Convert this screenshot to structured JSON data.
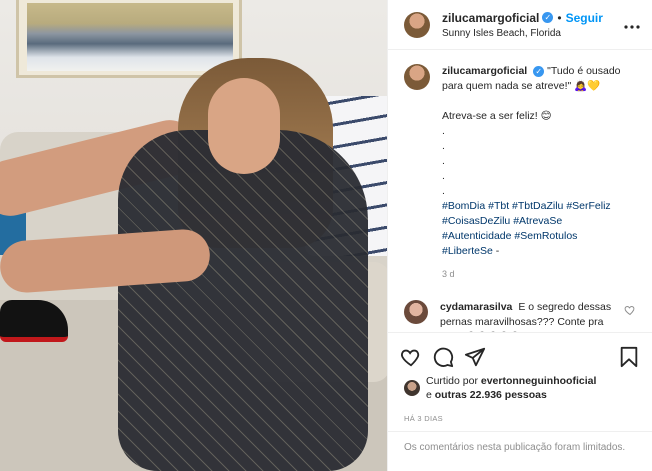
{
  "post": {
    "username": "zilucamargoficial",
    "follow_label": "Seguir",
    "separator": "•",
    "location": "Sunny Isles Beach, Florida",
    "more_label": "•••"
  },
  "caption": {
    "username": "zilucamargoficial",
    "lines": [
      "\"Tudo é ousado para quem nada se atreve!\" 🙇‍♀️💛",
      "",
      "Atreva-se a ser feliz! 😊",
      ".",
      ".",
      ".",
      ".",
      "."
    ],
    "hashtags": [
      "#BomDia",
      "#Tbt",
      "#TbtDaZilu",
      "#SerFeliz",
      "#CoisasDeZilu",
      "#AtrevaSe",
      "#Autenticidade",
      "#SemRotulos",
      "#LiberteSe"
    ],
    "hashtag_tail": " -",
    "time": "3 d"
  },
  "comment": {
    "username": "cydamarasilva",
    "text": "E o segredo dessas pernas maravilhosas??? Conte pra nós? 😍😍😍😍😍"
  },
  "likes": {
    "prefix": "Curtido por",
    "user": "evertonneguinhooficial",
    "joiner": "e",
    "count": "outras 22.936 pessoas"
  },
  "posted_ago": "HÁ 3 DIAS",
  "limited_notice": "Os comentários nesta publicação foram limitados.",
  "colors": {
    "accent": "#0095f6",
    "verified": "#3897f0",
    "hashtag": "#00376b",
    "muted": "#8e8e8e"
  },
  "icons": [
    "heart-icon",
    "comment-icon",
    "share-icon",
    "bookmark-icon",
    "verified-icon",
    "more-icon"
  ]
}
